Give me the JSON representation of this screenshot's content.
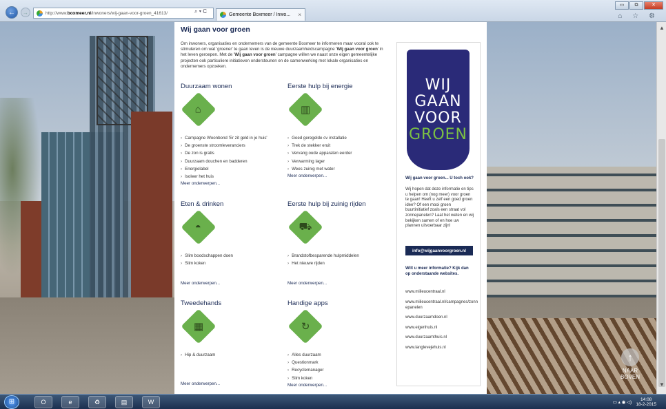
{
  "browser": {
    "address": {
      "prefix": "http://www.",
      "host": "boxmeer.nl",
      "path": "/inwoners/wij-gaan-voor-groen_41613/",
      "tools": "⌕ ▾ C"
    },
    "tab_title": "Gemeente Boxmeer / Inwo...",
    "tab_close": "×",
    "win_buttons": [
      "▭",
      "⧉",
      "✕"
    ],
    "toolbar_icons": "⌂ ☆ ⚙"
  },
  "page": {
    "title": "Wij gaan voor groen",
    "intro_parts": [
      "Om inwoners, organisaties en ondernemers van de gemeente Boxmeer te informeren maar vooral ook te stimuleren om wat 'groener' te gaan leven is de nieuwe duurzaamheidscampagne '",
      "Wij gaan voor groen",
      "' in het leven geroepen. Met de '",
      "Wij gaan voor groen",
      "' campagne willen we naast onze eigen gemeentelijke projecten ook particuliere initiatieven ondersteunen en de samenwerking met lokale organisaties en ondernemers opzoeken."
    ],
    "sections": [
      {
        "title": "Duurzaam wonen",
        "icon": "house-leaf-icon",
        "glyph": "⌂",
        "items": [
          "Campagne Woonbond 'Er zit geld in je huis'",
          "De groenste stroomleveranciers",
          "De zon is gratis",
          "Duurzaam douchen en badderen",
          "Energielabel",
          "Isoleer het huis"
        ],
        "more": "Meer onderwerpen..."
      },
      {
        "title": "Eerste hulp bij energie",
        "icon": "radiator-icon",
        "glyph": "▥",
        "items": [
          "Goed geregelde cv installatie",
          "Trek de stekker eruit",
          "Vervang oude apparaten eerder",
          "Verwarming lager",
          "Wees zuinig met water"
        ],
        "more": "Meer onderwerpen..."
      },
      {
        "title": "Eten & drinken",
        "icon": "food-cloche-icon",
        "glyph": "◓",
        "items": [
          "Slim boodschappen doen",
          "Slim koken"
        ],
        "more": "Meer onderwerpen..."
      },
      {
        "title": "Eerste hulp bij zuinig rijden",
        "icon": "car-icon",
        "glyph": "⛟",
        "items": [
          "Brandstofbesparende hulpmiddelen",
          "Het nieuwe rijden"
        ],
        "more": "Meer onderwerpen..."
      },
      {
        "title": "Tweedehands",
        "icon": "solar-panel-icon",
        "glyph": "▦",
        "items": [
          "Hip & duurzaam"
        ],
        "more": "Meer onderwerpen..."
      },
      {
        "title": "Handige apps",
        "icon": "refresh-plug-icon",
        "glyph": "↻",
        "items": [
          "Alles duurzaam",
          "Questionmark",
          "Recyclemanager",
          "Slim koken"
        ],
        "more": "Meer onderwerpen..."
      }
    ]
  },
  "sidebar": {
    "badge_lines": [
      "WIJ",
      "GAAN",
      "VOOR",
      "GROEN"
    ],
    "question": "Wij gaan voor groen... U toch ook?",
    "text": "Wij hopen dat deze informatie en tips u helpen om (nog meer) voor groen te gaan! Heeft u zelf een goed groen idee? Of een mooi groen buurtinitiatief zoals een straat vol zonnepanelen? Laat het weten en wij bekijken samen of en hoe uw plannen uitvoerbaar zijn!",
    "email_button": "info@wijgaanvoorgroen.nl",
    "more_info": "Wilt u meer informatie? Kijk dan op onderstaande websites.",
    "links": [
      "www.milieucentraal.nl",
      "www.milieucentraal.nl/campagnes/zonnepanelen",
      "www.duurzaamdoen.nl",
      "www.eigenhuis.nl",
      "www.duurzaamthuis.nl",
      "www.langlevejehuis.nl"
    ]
  },
  "back_to_top": {
    "line1": "NAAR",
    "line2": "BOVEN"
  },
  "taskbar": {
    "apps": [
      "O",
      "e",
      "♻",
      "▤",
      "W"
    ],
    "tray_icons": "▭ ▴ ◉ ◁)",
    "time": "14:08",
    "date": "18-2-2015"
  }
}
